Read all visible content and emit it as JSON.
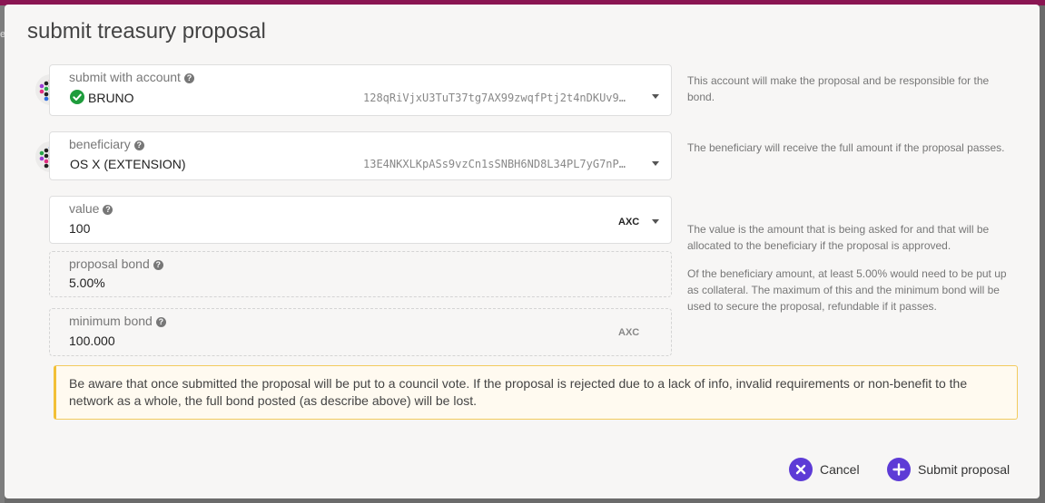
{
  "dialog": {
    "title": "submit treasury proposal"
  },
  "account": {
    "label": "submit with account",
    "name": "BRUNO",
    "address": "128qRiVjxU3TuT37tg7AX99zwqfPtj2t4nDKUv9…",
    "hint": "This account will make the proposal and be responsible for the bond."
  },
  "beneficiary": {
    "label": "beneficiary",
    "name": "OS X (EXTENSION)",
    "address": "13E4NKXLKpASs9vzCn1sSNBH6ND8L34PL7yG7nP…",
    "hint": "The beneficiary will receive the full amount if the proposal passes."
  },
  "value": {
    "label": "value",
    "amount": "100",
    "unit": "AXC",
    "hint": "The value is the amount that is being asked for and that will be allocated to the beneficiary if the proposal is approved."
  },
  "proposal_bond": {
    "label": "proposal bond",
    "amount": "5.00%",
    "hint": "Of the beneficiary amount, at least 5.00% would need to be put up as collateral. The maximum of this and the minimum bond will be used to secure the proposal, refundable if it passes."
  },
  "minimum_bond": {
    "label": "minimum bond",
    "amount": "100.000",
    "unit": "AXC"
  },
  "warning": {
    "text": "Be aware that once submitted the proposal will be put to a council vote. If the proposal is rejected due to a lack of info, invalid requirements or non-benefit to the network as a whole, the full bond posted (as describe above) will be lost."
  },
  "actions": {
    "cancel_label": "Cancel",
    "submit_label": "Submit proposal"
  },
  "colors": {
    "brand_bar": "#8a1552",
    "accent": "#5d3bd6",
    "success": "#1e9c3c",
    "warning_border": "#f2c037"
  },
  "icons": [
    "help-icon",
    "check-icon",
    "caret-down-icon",
    "close-icon",
    "plus-icon",
    "identicon"
  ]
}
